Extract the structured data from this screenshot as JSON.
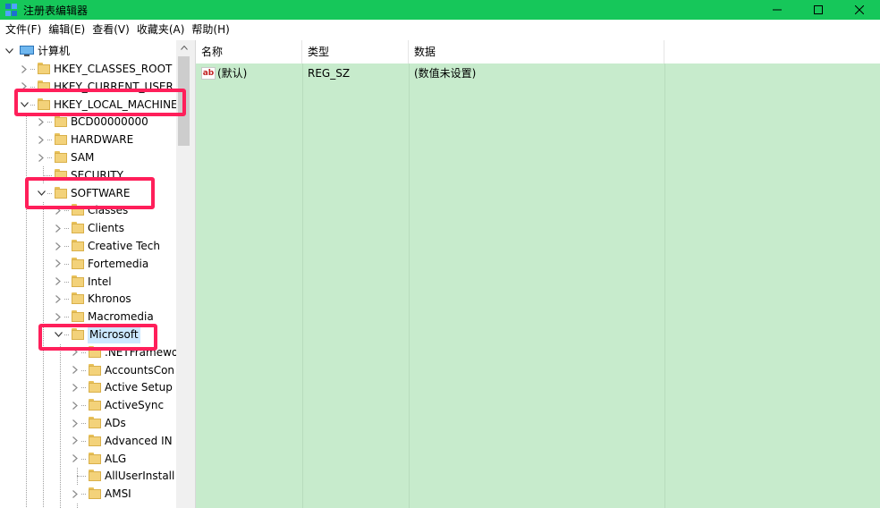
{
  "window": {
    "title": "注册表编辑器"
  },
  "menu": [
    {
      "label": "文件(F)"
    },
    {
      "label": "编辑(E)"
    },
    {
      "label": "查看(V)"
    },
    {
      "label": "收藏夹(A)"
    },
    {
      "label": "帮助(H)"
    }
  ],
  "tree": {
    "root": "计算机",
    "items": [
      {
        "label": "HKEY_CLASSES_ROOT",
        "state": "collapsed"
      },
      {
        "label": "HKEY_CURRENT_USER",
        "state": "collapsed"
      },
      {
        "label": "HKEY_LOCAL_MACHINE",
        "state": "expanded"
      },
      {
        "label": "BCD00000000",
        "state": "collapsed"
      },
      {
        "label": "HARDWARE",
        "state": "collapsed"
      },
      {
        "label": "SAM",
        "state": "collapsed"
      },
      {
        "label": "SECURITY",
        "state": "none"
      },
      {
        "label": "SOFTWARE",
        "state": "expanded"
      },
      {
        "label": "Classes",
        "state": "collapsed"
      },
      {
        "label": "Clients",
        "state": "collapsed"
      },
      {
        "label": "Creative Tech",
        "state": "collapsed"
      },
      {
        "label": "Fortemedia",
        "state": "collapsed"
      },
      {
        "label": "Intel",
        "state": "collapsed"
      },
      {
        "label": "Khronos",
        "state": "collapsed"
      },
      {
        "label": "Macromedia",
        "state": "collapsed"
      },
      {
        "label": "Microsoft",
        "state": "expanded"
      },
      {
        "label": ".NETFramewo",
        "state": "collapsed"
      },
      {
        "label": "AccountsCon",
        "state": "collapsed"
      },
      {
        "label": "Active Setup",
        "state": "collapsed"
      },
      {
        "label": "ActiveSync",
        "state": "collapsed"
      },
      {
        "label": "ADs",
        "state": "collapsed"
      },
      {
        "label": "Advanced IN",
        "state": "collapsed"
      },
      {
        "label": "ALG",
        "state": "collapsed"
      },
      {
        "label": "AllUserInstall",
        "state": "none"
      },
      {
        "label": "AMSI",
        "state": "collapsed"
      }
    ]
  },
  "list": {
    "columns": [
      "名称",
      "类型",
      "数据"
    ],
    "rows": [
      {
        "name": "(默认)",
        "type": "REG_SZ",
        "data": "(数值未设置)"
      }
    ]
  },
  "colors": {
    "titlebar": "#16c75a",
    "list_background": "#c7ebcc",
    "highlight": "#ff1f5a",
    "selection": "#cce8ff"
  }
}
